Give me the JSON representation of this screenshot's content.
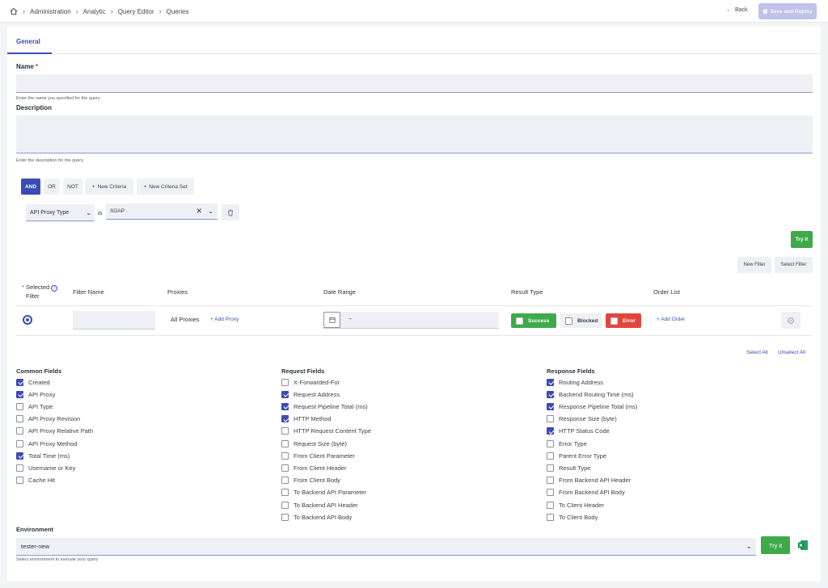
{
  "breadcrumb": [
    "Administration",
    "Analytic",
    "Query Editor",
    "Queries"
  ],
  "header": {
    "back_label": "Back",
    "save_label": "Save and Deploy"
  },
  "tabs": [
    {
      "label": "General"
    }
  ],
  "form": {
    "name_label": "Name",
    "name_required": "*",
    "name_hint": "Enter the name you specified for the query",
    "description_label": "Description",
    "description_hint": "Enter the description for the query"
  },
  "criteria": {
    "and": "AND",
    "or": "OR",
    "not": "NOT",
    "new_criteria": "New Criteria",
    "new_criteria_set": "New Criteria Set",
    "field": "API Proxy Type",
    "operator": "is",
    "value": "SOAP"
  },
  "try_it_small": "Try it",
  "filters": {
    "new_filter": "New Filter",
    "select_filter": "Select Filter",
    "headers": {
      "selected_required": "*",
      "selected_line1": "Selected",
      "selected_line2": "Filter",
      "filter_name": "Filter Name",
      "proxies": "Proxies",
      "date_range": "Date Range",
      "result_type": "Result Type",
      "order_list": "Order List"
    },
    "row": {
      "proxies": "All Proxies",
      "add_proxy": "Add Proxy",
      "date_arrow": "→",
      "success": "Success",
      "blocked": "Blocked",
      "error": "Error",
      "add_order": "Add Order"
    },
    "colors": {
      "success": "#3eaa4a",
      "error": "#e2453c",
      "accent": "#3b4bb4"
    }
  },
  "select_all": "Select All",
  "unselect_all": "Unselect All",
  "fields": {
    "common": {
      "title": "Common Fields",
      "items": [
        {
          "label": "Created",
          "checked": true
        },
        {
          "label": "API Proxy",
          "checked": true
        },
        {
          "label": "API Type",
          "checked": false
        },
        {
          "label": "API Proxy Revision",
          "checked": false
        },
        {
          "label": "API Proxy Relative Path",
          "checked": false
        },
        {
          "label": "API Proxy Method",
          "checked": false
        },
        {
          "label": "Total Time (ms)",
          "checked": true
        },
        {
          "label": "Username or Key",
          "checked": false
        },
        {
          "label": "Cache Hit",
          "checked": false
        }
      ]
    },
    "request": {
      "title": "Request Fields",
      "items": [
        {
          "label": "X-Forwarded-For",
          "checked": false
        },
        {
          "label": "Request Address",
          "checked": true
        },
        {
          "label": "Request Pipeline Total (ms)",
          "checked": true
        },
        {
          "label": "HTTP Method",
          "checked": true
        },
        {
          "label": "HTTP Request Content Type",
          "checked": false
        },
        {
          "label": "Request Size (byte)",
          "checked": false
        },
        {
          "label": "From Client Parameter",
          "checked": false
        },
        {
          "label": "From Client Header",
          "checked": false
        },
        {
          "label": "From Client Body",
          "checked": false
        },
        {
          "label": "To Backend API Parameter",
          "checked": false
        },
        {
          "label": "To Backend API Header",
          "checked": false
        },
        {
          "label": "To Backend API Body",
          "checked": false
        }
      ]
    },
    "response": {
      "title": "Response Fields",
      "items": [
        {
          "label": "Routing Address",
          "checked": true
        },
        {
          "label": "Backend Routing Time (ms)",
          "checked": true
        },
        {
          "label": "Response Pipeline Total (ms)",
          "checked": true
        },
        {
          "label": "Response Size (byte)",
          "checked": false
        },
        {
          "label": "HTTP Status Code",
          "checked": true
        },
        {
          "label": "Error Type",
          "checked": false
        },
        {
          "label": "Parent Error Type",
          "checked": false
        },
        {
          "label": "Result Type",
          "checked": false
        },
        {
          "label": "From Backend API Header",
          "checked": false
        },
        {
          "label": "From Backend API Body",
          "checked": false
        },
        {
          "label": "To Client Header",
          "checked": false
        },
        {
          "label": "To Client Body",
          "checked": false
        }
      ]
    }
  },
  "environment": {
    "label": "Environment",
    "value": "tester-new",
    "hint": "Select environment to execute your query",
    "try_it": "Try it"
  }
}
